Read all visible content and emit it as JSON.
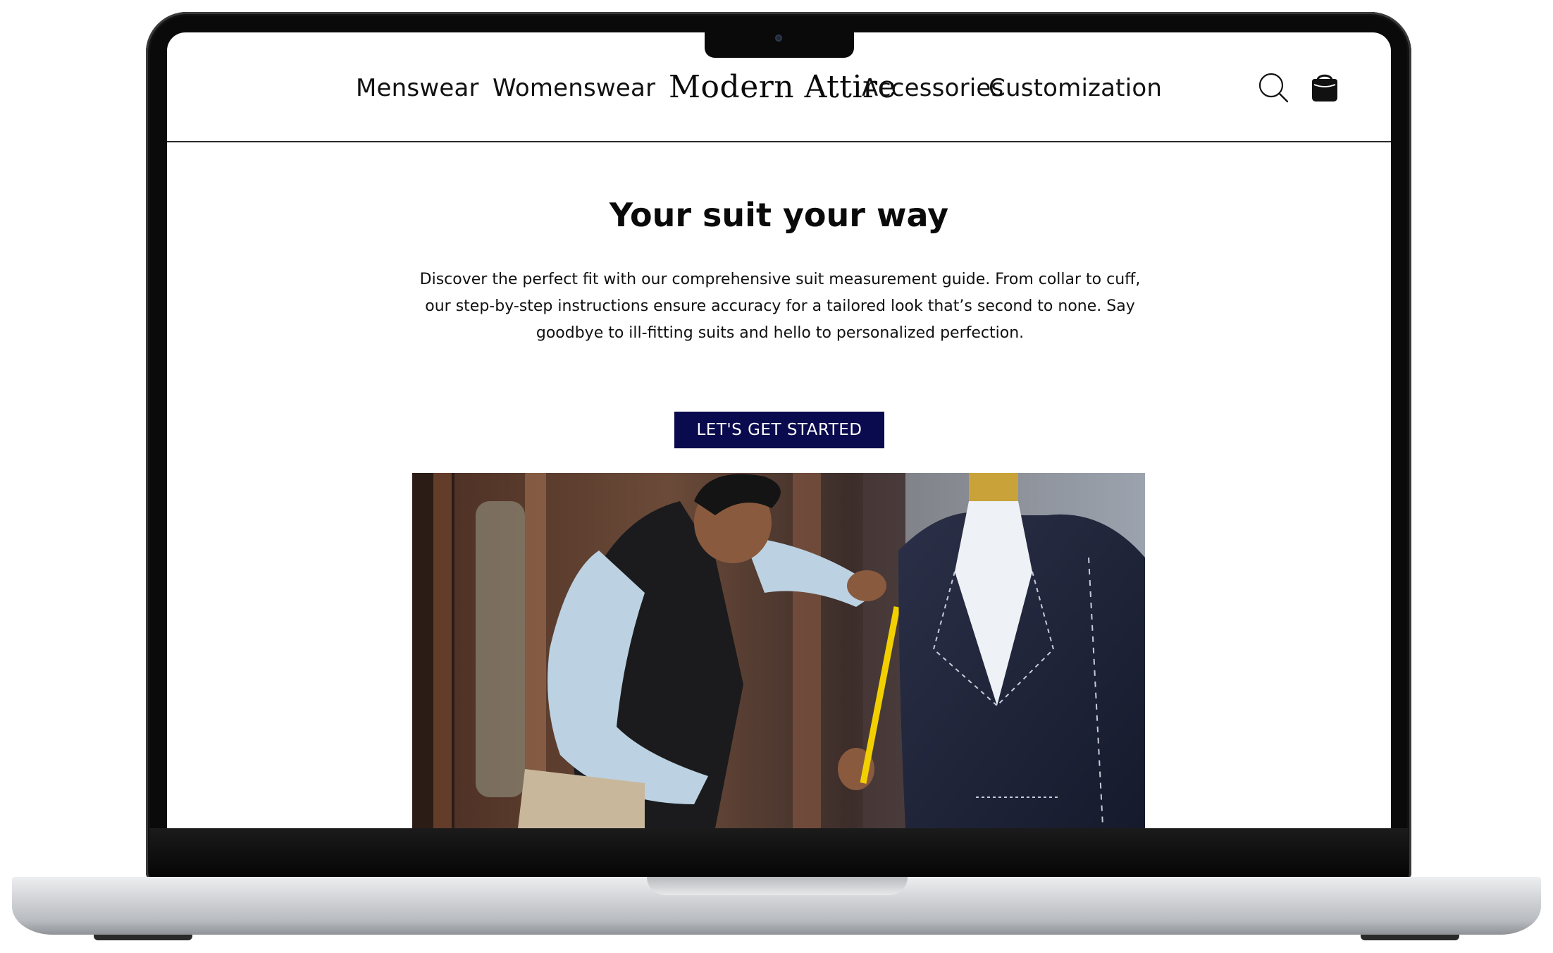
{
  "nav": {
    "left": [
      "Menswear",
      "Womenswear"
    ],
    "brand": "Modern Attire",
    "right": [
      "Accessories",
      "Customization"
    ],
    "search_icon": "search-icon",
    "bag_icon": "shopping-bag-icon"
  },
  "hero": {
    "title": "Your suit your way",
    "description": "Discover the perfect fit with our comprehensive suit measurement guide. From collar to cuff, our step-by-step instructions ensure accuracy for a tailored look that’s second to none. Say goodbye to ill-fitting suits and hello to personalized perfection.",
    "cta_label": "LET'S GET STARTED",
    "image_subject": "tailor-measuring-suit-on-mannequin"
  },
  "colors": {
    "cta_background": "#0a0a4e",
    "text": "#111111",
    "divider": "#2b2b2b"
  }
}
